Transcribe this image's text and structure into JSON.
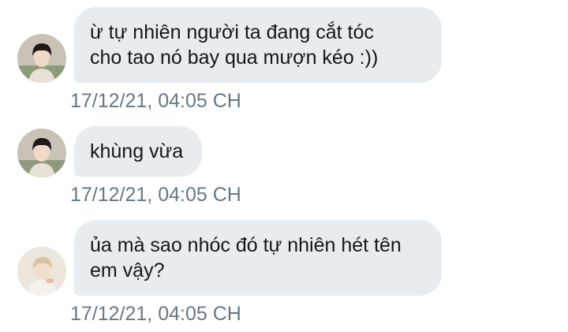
{
  "messages": [
    {
      "lines": [
        "ừ tự nhiên người ta đang cắt tóc",
        "cho tao nó bay qua mượn kéo :))"
      ],
      "timestamp": "17/12/21, 04:05 CH",
      "avatar": "avatar-dark-hair"
    },
    {
      "lines": [
        "khùng vừa"
      ],
      "timestamp": "17/12/21, 04:05 CH",
      "avatar": "avatar-dark-hair"
    },
    {
      "lines": [
        "ủa mà sao nhóc đó tự nhiên hét tên",
        "em vậy?"
      ],
      "timestamp": "17/12/21, 04:05 CH",
      "avatar": "avatar-light-hair"
    }
  ],
  "colors": {
    "bubble": "#e6ecf0",
    "text": "#14171a",
    "timestamp": "#657786",
    "background": "#ffffff"
  }
}
